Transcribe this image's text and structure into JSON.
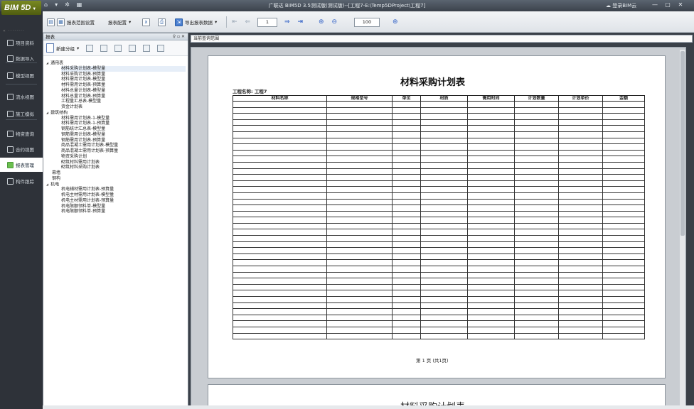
{
  "app": {
    "logo": "BIM 5D",
    "window_title": "广联达 BIM5D 3.5测试版(测试版)--[工程7-E:\\Temp5DProject\\工程7]",
    "login": "登录BIM云",
    "window_controls": [
      "—",
      "▢",
      "✕"
    ]
  },
  "toolbar": {
    "range_settings": "报表范围设置",
    "report_config": "报表配置",
    "export_data": "导出报表数据",
    "page_value": "1",
    "zoom_value": "100"
  },
  "nav": {
    "items": [
      {
        "label": "项目资料",
        "icon": "folder-icon"
      },
      {
        "label": "数据导入",
        "icon": "import-icon"
      },
      {
        "label": "模型视图",
        "icon": "model-icon"
      },
      {
        "label": "流水视图",
        "icon": "flow-icon"
      },
      {
        "label": "施工模拟",
        "icon": "simulation-icon"
      },
      {
        "label": "物资查询",
        "icon": "material-icon"
      },
      {
        "label": "合约视图",
        "icon": "contract-icon"
      },
      {
        "label": "报表管理",
        "icon": "report-icon",
        "active": true
      },
      {
        "label": "构件跟踪",
        "icon": "track-icon"
      }
    ]
  },
  "panel": {
    "title": "报表",
    "pin": "♀ ▫ ✕",
    "new_group": "新建分组"
  },
  "tree": [
    {
      "label": "通用表",
      "level": 0,
      "group": true
    },
    {
      "label": "材料采购计划表-模型量",
      "level": 1,
      "selected": true
    },
    {
      "label": "材料采购计划表-预算量",
      "level": 1
    },
    {
      "label": "材料需用计划表-模型量",
      "level": 1
    },
    {
      "label": "材料需用计划表-预算量",
      "level": 1
    },
    {
      "label": "材料总量计划表-模型量",
      "level": 1
    },
    {
      "label": "材料总量计划表-预算量",
      "level": 1
    },
    {
      "label": "工程量汇总表-模型量",
      "level": 1
    },
    {
      "label": "资金计划表",
      "level": 1
    },
    {
      "label": "建筑结构",
      "level": 0,
      "group": true
    },
    {
      "label": "材料需用计划表-1-模型量",
      "level": 1
    },
    {
      "label": "材料需用计划表-1-预算量",
      "level": 1
    },
    {
      "label": "钢筋统计汇总表-模型量",
      "level": 1
    },
    {
      "label": "钢筋需用计划表-模型量",
      "level": 1
    },
    {
      "label": "钢筋需用计划表-预算量",
      "level": 1
    },
    {
      "label": "商品混凝土需用计划表-模型量",
      "level": 1
    },
    {
      "label": "商品混凝土需用计划表-预算量",
      "level": 1
    },
    {
      "label": "物资采购计划",
      "level": 1
    },
    {
      "label": "砌筑材料需用计划表",
      "level": 1
    },
    {
      "label": "砌筑材料采购计划表",
      "level": 1
    },
    {
      "label": "幕墙",
      "level": 0
    },
    {
      "label": "钢构",
      "level": 0
    },
    {
      "label": "机电",
      "level": 0,
      "group": true
    },
    {
      "label": "机电辅材需用计划表-预算量",
      "level": 1
    },
    {
      "label": "机电主材需用计划表-模型量",
      "level": 1
    },
    {
      "label": "机电主材需用计划表-预算量",
      "level": 1
    },
    {
      "label": "机电限额领料单-模型量",
      "level": 1
    },
    {
      "label": "机电限额领料单-预算量",
      "level": 1
    }
  ],
  "preview": {
    "tab": "当前查询范围",
    "report_title": "材料采购计划表",
    "project_name": "工程名称: 工程7",
    "columns": [
      "材料名称",
      "规格型号",
      "单位",
      "材质",
      "需用时间",
      "计划数量",
      "计划单价",
      "金额"
    ],
    "row_count": 39,
    "footer": "第 1 页 (共1页)",
    "next_page_title": "材料采购计划表"
  }
}
